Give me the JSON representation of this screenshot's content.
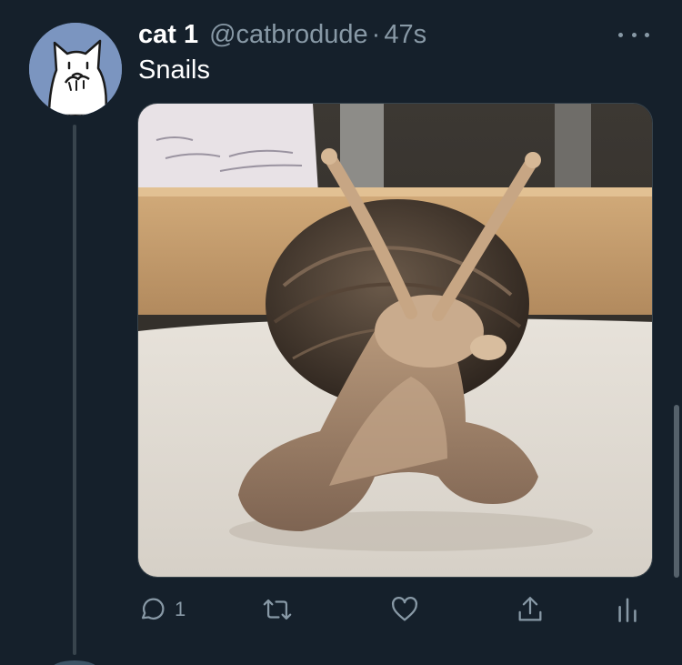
{
  "tweet": {
    "display_name": "cat 1",
    "handle": "@catbrodude",
    "separator": "·",
    "timestamp": "47s",
    "text": "Snails",
    "media_alt": "snail on a table"
  },
  "actions": {
    "reply_count": "1"
  },
  "colors": {
    "background": "#15202b",
    "secondary_text": "#8899a6",
    "avatar_bg": "#7b95c0",
    "divider": "#38444d"
  },
  "icons": [
    "cat-avatar",
    "more-icon",
    "reply-icon",
    "retweet-icon",
    "like-icon",
    "share-icon",
    "analytics-icon"
  ]
}
